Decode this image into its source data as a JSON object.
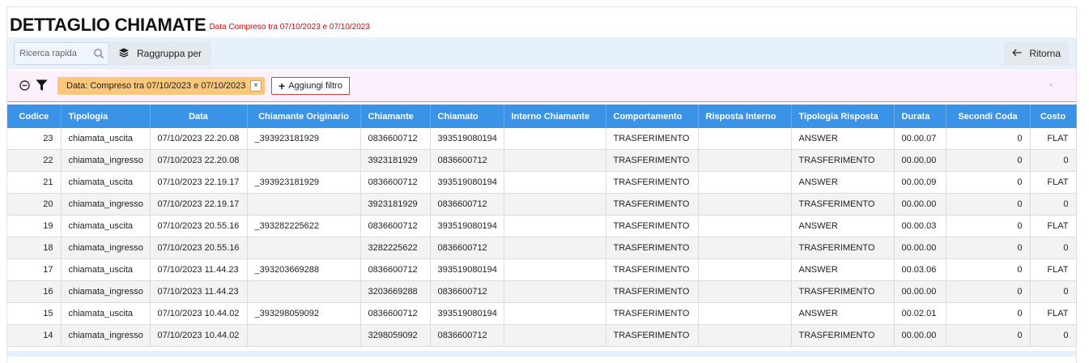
{
  "page": {
    "title": "DETTAGLIO CHIAMATE",
    "subtitle": "Data Compreso tra 07/10/2023 e 07/10/2023"
  },
  "toolbar": {
    "search_placeholder": "Ricerca rapida",
    "group_label": "Raggruppa per",
    "back_label": "Ritorna"
  },
  "filters": {
    "active_chip": "Data: Compreso tra 07/10/2023 e 07/10/2023",
    "chip_remove": "×",
    "add_label": "Aggiungi filtro",
    "add_plus": "+",
    "close": "×"
  },
  "table": {
    "columns": [
      "Codice",
      "Tipologia",
      "Data",
      "Chiamante Originario",
      "Chiamante",
      "Chiamato",
      "Interno Chiamante",
      "Comportamento",
      "Risposta Interno",
      "Tipologia Risposta",
      "Durata",
      "Secondi Coda",
      "Costo"
    ],
    "rows": [
      [
        "23",
        "chiamata_uscita",
        "07/10/2023 22.20.08",
        "_393923181929",
        "0836600712",
        "393519080194",
        "",
        "TRASFERIMENTO",
        "",
        "ANSWER",
        "00.00.07",
        "0",
        "FLAT"
      ],
      [
        "22",
        "chiamata_ingresso",
        "07/10/2023 22.20.08",
        "",
        "3923181929",
        "0836600712",
        "",
        "TRASFERIMENTO",
        "",
        "TRASFERIMENTO",
        "00.00.00",
        "0",
        "0"
      ],
      [
        "21",
        "chiamata_uscita",
        "07/10/2023 22.19.17",
        "_393923181929",
        "0836600712",
        "393519080194",
        "",
        "TRASFERIMENTO",
        "",
        "ANSWER",
        "00.00.09",
        "0",
        "FLAT"
      ],
      [
        "20",
        "chiamata_ingresso",
        "07/10/2023 22.19.17",
        "",
        "3923181929",
        "0836600712",
        "",
        "TRASFERIMENTO",
        "",
        "TRASFERIMENTO",
        "00.00.00",
        "0",
        "0"
      ],
      [
        "19",
        "chiamata_uscita",
        "07/10/2023 20.55.16",
        "_393282225622",
        "0836600712",
        "393519080194",
        "",
        "TRASFERIMENTO",
        "",
        "ANSWER",
        "00.00.03",
        "0",
        "FLAT"
      ],
      [
        "18",
        "chiamata_ingresso",
        "07/10/2023 20.55.16",
        "",
        "3282225622",
        "0836600712",
        "",
        "TRASFERIMENTO",
        "",
        "TRASFERIMENTO",
        "00.00.00",
        "0",
        "0"
      ],
      [
        "17",
        "chiamata_uscita",
        "07/10/2023 11.44.23",
        "_393203669288",
        "0836600712",
        "393519080194",
        "",
        "TRASFERIMENTO",
        "",
        "ANSWER",
        "00.03.06",
        "0",
        "FLAT"
      ],
      [
        "16",
        "chiamata_ingresso",
        "07/10/2023 11.44.23",
        "",
        "3203669288",
        "0836600712",
        "",
        "TRASFERIMENTO",
        "",
        "TRASFERIMENTO",
        "00.00.00",
        "0",
        "0"
      ],
      [
        "15",
        "chiamata_uscita",
        "07/10/2023 10.44.02",
        "_393298059092",
        "0836600712",
        "393519080194",
        "",
        "TRASFERIMENTO",
        "",
        "ANSWER",
        "00.02.01",
        "0",
        "FLAT"
      ],
      [
        "14",
        "chiamata_ingresso",
        "07/10/2023 10.44.02",
        "",
        "3298059092",
        "0836600712",
        "",
        "TRASFERIMENTO",
        "",
        "TRASFERIMENTO",
        "00.00.00",
        "0",
        "0"
      ]
    ]
  },
  "colors": {
    "header_bg": "#3a93e6",
    "toolbar_bg": "#e6f1fb",
    "filterbar_bg": "#fcf0fc",
    "chip_bg": "#fbc77a",
    "title_accent": "#e00000"
  },
  "icons": {
    "search": "search-icon",
    "group": "layers-icon",
    "back": "arrow-left-icon",
    "collapse": "minus-circle-icon",
    "filter": "funnel-icon"
  }
}
